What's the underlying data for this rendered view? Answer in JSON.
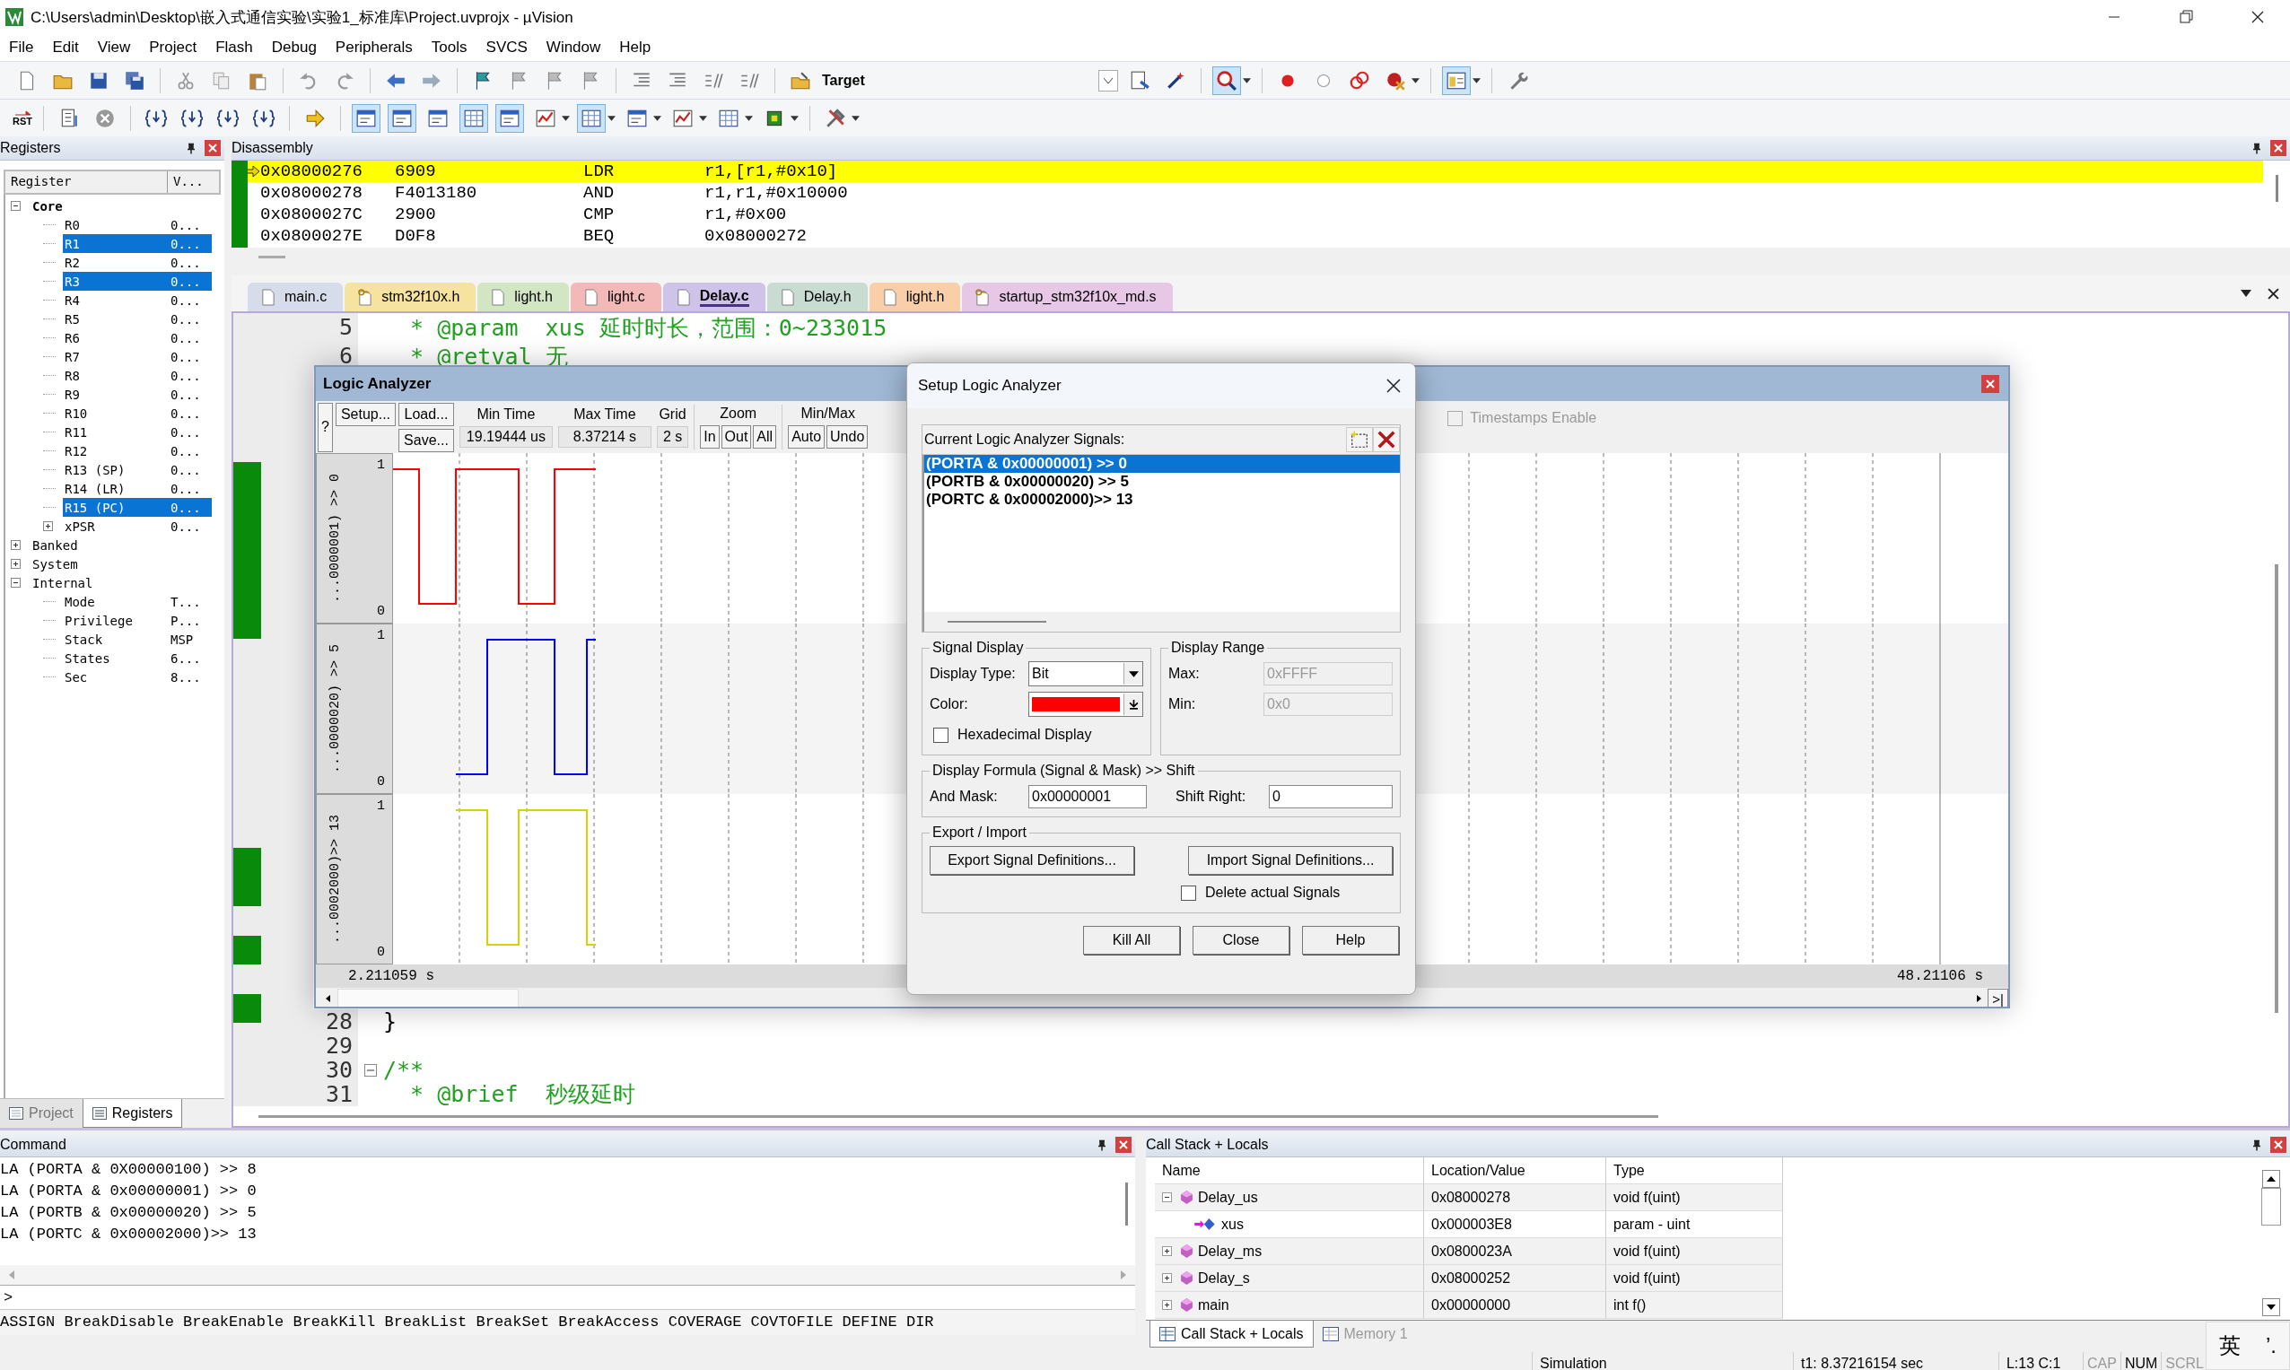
{
  "window": {
    "title": "C:\\Users\\admin\\Desktop\\嵌入式通信实验\\实验1_标准库\\Project.uvprojx - µVision"
  },
  "menu": [
    "File",
    "Edit",
    "View",
    "Project",
    "Flash",
    "Debug",
    "Peripherals",
    "Tools",
    "SVCS",
    "Window",
    "Help"
  ],
  "toolbar": {
    "target": "Target",
    "debug_session": {
      "pressed": true
    },
    "window_layout": {
      "pressed": true
    },
    "reset_label": "RST",
    "window_buttons": [
      {
        "pressed": true
      },
      {
        "pressed": true
      },
      {
        "pressed": false
      },
      {
        "pressed": true
      },
      {
        "pressed": true
      },
      {
        "pressed": false
      },
      {
        "pressed": true
      },
      {
        "pressed": false
      },
      {
        "pressed": false
      },
      {
        "pressed": false
      },
      {
        "pressed": false
      }
    ]
  },
  "registers_panel": {
    "title": "Registers",
    "columns": [
      "Register",
      "V..."
    ],
    "tree": [
      {
        "label": "Core",
        "bold": true,
        "expanded": true,
        "highlighted": false,
        "children": [
          {
            "label": "R0",
            "value": "0...",
            "highlighted": false
          },
          {
            "label": "R1",
            "value": "0...",
            "highlighted": true
          },
          {
            "label": "R2",
            "value": "0...",
            "highlighted": false
          },
          {
            "label": "R3",
            "value": "0...",
            "highlighted": true
          },
          {
            "label": "R4",
            "value": "0...",
            "highlighted": false
          },
          {
            "label": "R5",
            "value": "0...",
            "highlighted": false
          },
          {
            "label": "R6",
            "value": "0...",
            "highlighted": false
          },
          {
            "label": "R7",
            "value": "0...",
            "highlighted": false
          },
          {
            "label": "R8",
            "value": "0...",
            "highlighted": false
          },
          {
            "label": "R9",
            "value": "0...",
            "highlighted": false
          },
          {
            "label": "R10",
            "value": "0...",
            "highlighted": false
          },
          {
            "label": "R11",
            "value": "0...",
            "highlighted": false
          },
          {
            "label": "R12",
            "value": "0...",
            "highlighted": false
          },
          {
            "label": "R13 (SP)",
            "value": "0...",
            "highlighted": false
          },
          {
            "label": "R14 (LR)",
            "value": "0...",
            "highlighted": false
          },
          {
            "label": "R15 (PC)",
            "value": "0...",
            "highlighted": true
          },
          {
            "label": "xPSR",
            "value": "0...",
            "expanded": false,
            "highlighted": false
          }
        ]
      },
      {
        "label": "Banked",
        "bold": false,
        "expanded": false,
        "highlighted": false
      },
      {
        "label": "System",
        "bold": false,
        "expanded": false,
        "highlighted": false
      },
      {
        "label": "Internal",
        "bold": false,
        "expanded": true,
        "highlighted": false,
        "children": [
          {
            "label": "Mode",
            "value": "T...",
            "highlighted": false
          },
          {
            "label": "Privilege",
            "value": "P...",
            "highlighted": false
          },
          {
            "label": "Stack",
            "value": "MSP",
            "highlighted": false
          },
          {
            "label": "States",
            "value": "6...",
            "highlighted": false
          },
          {
            "label": "Sec",
            "value": "8...",
            "highlighted": false
          }
        ]
      }
    ],
    "tabs": [
      {
        "label": "Project",
        "selected": false
      },
      {
        "label": "Registers",
        "selected": true
      }
    ]
  },
  "disassembly": {
    "title": "Disassembly",
    "rows": [
      {
        "address": "0x08000276",
        "opcode": "6909",
        "mnemonic": "LDR",
        "operands": "r1,[r1,#0x10]",
        "current": true
      },
      {
        "address": "0x08000278",
        "opcode": "F4013180",
        "mnemonic": "AND",
        "operands": "r1,r1,#0x10000",
        "current": false
      },
      {
        "address": "0x0800027C",
        "opcode": "2900",
        "mnemonic": "CMP",
        "operands": "r1,#0x00",
        "current": false
      },
      {
        "address": "0x0800027E",
        "opcode": "D0F8",
        "mnemonic": "BEQ",
        "operands": "0x08000272",
        "current": false
      }
    ]
  },
  "editor": {
    "tabs": [
      {
        "label": "main.c",
        "kind": "file",
        "color": "#d6dcea",
        "selected": false
      },
      {
        "label": "stm32f10x.h",
        "kind": "readonly",
        "color": "#f6e3a0",
        "selected": false
      },
      {
        "label": "light.h",
        "kind": "file",
        "color": "#d3e6c4",
        "selected": false
      },
      {
        "label": "light.c",
        "kind": "file",
        "color": "#f3b8b8",
        "selected": false
      },
      {
        "label": "Delay.c",
        "kind": "file",
        "color": "#cfc3ea",
        "selected": true
      },
      {
        "label": "Delay.h",
        "kind": "file",
        "color": "#c9dcd2",
        "selected": false
      },
      {
        "label": "light.h",
        "kind": "file",
        "color": "#f8cfa8",
        "selected": false
      },
      {
        "label": "startup_stm32f10x_md.s",
        "kind": "readonly",
        "color": "#e6c7e6",
        "selected": false
      }
    ],
    "top_lines": [
      {
        "number": "5",
        "text": "  * @param  xus 延时时长，范围：0~233015",
        "fold": false
      },
      {
        "number": "6",
        "text": "  * @retval 无",
        "fold": false
      }
    ],
    "bottom_lines": [
      {
        "number": "28",
        "text": "}",
        "fold": false
      },
      {
        "number": "29",
        "fold": false
      },
      {
        "number": "30",
        "text": "/**",
        "fold": true
      },
      {
        "number": "31",
        "text": "  * @brief  秒级延时",
        "fold": false
      }
    ]
  },
  "logic_analyzer": {
    "title": "Logic Analyzer",
    "setup_button": "Setup...",
    "load_button": "Load...",
    "save_button": "Save...",
    "help_button": "?",
    "min_time": {
      "label": "Min Time",
      "value": "19.19444 us"
    },
    "max_time": {
      "label": "Max Time",
      "value": "8.37214 s"
    },
    "grid": {
      "label": "Grid",
      "value": "2 s"
    },
    "zoom": {
      "label": "Zoom",
      "buttons": [
        "In",
        "Out",
        "All"
      ]
    },
    "min_max": {
      "label": "Min/Max",
      "buttons": [
        "Auto",
        "Undo"
      ]
    },
    "timestamps": {
      "label": "Timestamps Enable",
      "checked": false,
      "disabled": true
    },
    "channels": [
      {
        "label": "...0000001) >> 0",
        "high": "1",
        "low": "0",
        "color": "#ff0000"
      },
      {
        "label": "...0000020) >> 5",
        "high": "1",
        "low": "0",
        "color": "#0000ff"
      },
      {
        "label": "...0002000)>> 13",
        "high": "1",
        "low": "0",
        "color": "#d4d400"
      }
    ],
    "start_time": "2.211059 s",
    "end_time": "48.21106 s",
    "end_button": ">|"
  },
  "setup_dialog": {
    "title": "Setup Logic Analyzer",
    "signals_label": "Current Logic Analyzer Signals:",
    "signals": [
      {
        "text": "(PORTA & 0x00000001) >> 0",
        "selected": true
      },
      {
        "text": "(PORTB & 0x00000020) >> 5",
        "selected": false
      },
      {
        "text": "(PORTC & 0x00002000)>> 13",
        "selected": false
      }
    ],
    "signal_display": {
      "title": "Signal Display",
      "type_label": "Display Type:",
      "type": "Bit",
      "color_label": "Color:",
      "color": "#ff0000",
      "hex_label": "Hexadecimal Display",
      "hex_checked": false
    },
    "display_range": {
      "title": "Display Range",
      "max_label": "Max:",
      "max": "0xFFFF",
      "min_label": "Min:",
      "min": "0x0",
      "disabled": true
    },
    "formula": {
      "title": "Display Formula (Signal & Mask) >> Shift",
      "mask_label": "And Mask:",
      "mask": "0x00000001",
      "shift_label": "Shift Right:",
      "shift": "0"
    },
    "export_import": {
      "title": "Export / Import",
      "export_button": "Export Signal Definitions...",
      "import_button": "Import Signal Definitions...",
      "delete_label": "Delete actual Signals",
      "delete_checked": false
    },
    "buttons": [
      "Kill All",
      "Close",
      "Help"
    ]
  },
  "command": {
    "title": "Command",
    "lines": [
      "LA (PORTA & 0X00000100) >> 8",
      "LA (PORTA & 0x00000001) >> 0",
      "LA (PORTB & 0x00000020) >> 5",
      "LA (PORTC & 0x00002000)>> 13"
    ],
    "prompt": ">",
    "hint": "ASSIGN BreakDisable BreakEnable BreakKill BreakList BreakSet BreakAccess COVERAGE COVTOFILE DEFINE DIR"
  },
  "call_stack": {
    "title": "Call Stack + Locals",
    "columns": [
      "Name",
      "Location/Value",
      "Type"
    ],
    "rows": [
      {
        "name": "Delay_us",
        "value": "0x08000278",
        "type": "void f(uint)",
        "expanded": true,
        "children": [
          {
            "name": "xus",
            "value": "0x000003E8",
            "type": "param - uint"
          }
        ]
      },
      {
        "name": "Delay_ms",
        "value": "0x0800023A",
        "type": "void f(uint)",
        "expanded": false
      },
      {
        "name": "Delay_s",
        "value": "0x08000252",
        "type": "void f(uint)",
        "expanded": false
      },
      {
        "name": "main",
        "value": "0x00000000",
        "type": "int f()",
        "expanded": false
      }
    ],
    "tabs": [
      {
        "label": "Call Stack + Locals",
        "selected": true
      },
      {
        "label": "Memory 1",
        "selected": false
      }
    ]
  },
  "status_bar": {
    "mode": "Simulation",
    "time": "t1: 8.37216154 sec",
    "position": "L:13 C:1",
    "indicators": [
      {
        "label": "CAP",
        "on": false
      },
      {
        "label": "NUM",
        "on": true
      },
      {
        "label": "SCRL",
        "on": false
      }
    ]
  },
  "ime_toolbar": {
    "language": "英",
    "punctuation": "’."
  }
}
